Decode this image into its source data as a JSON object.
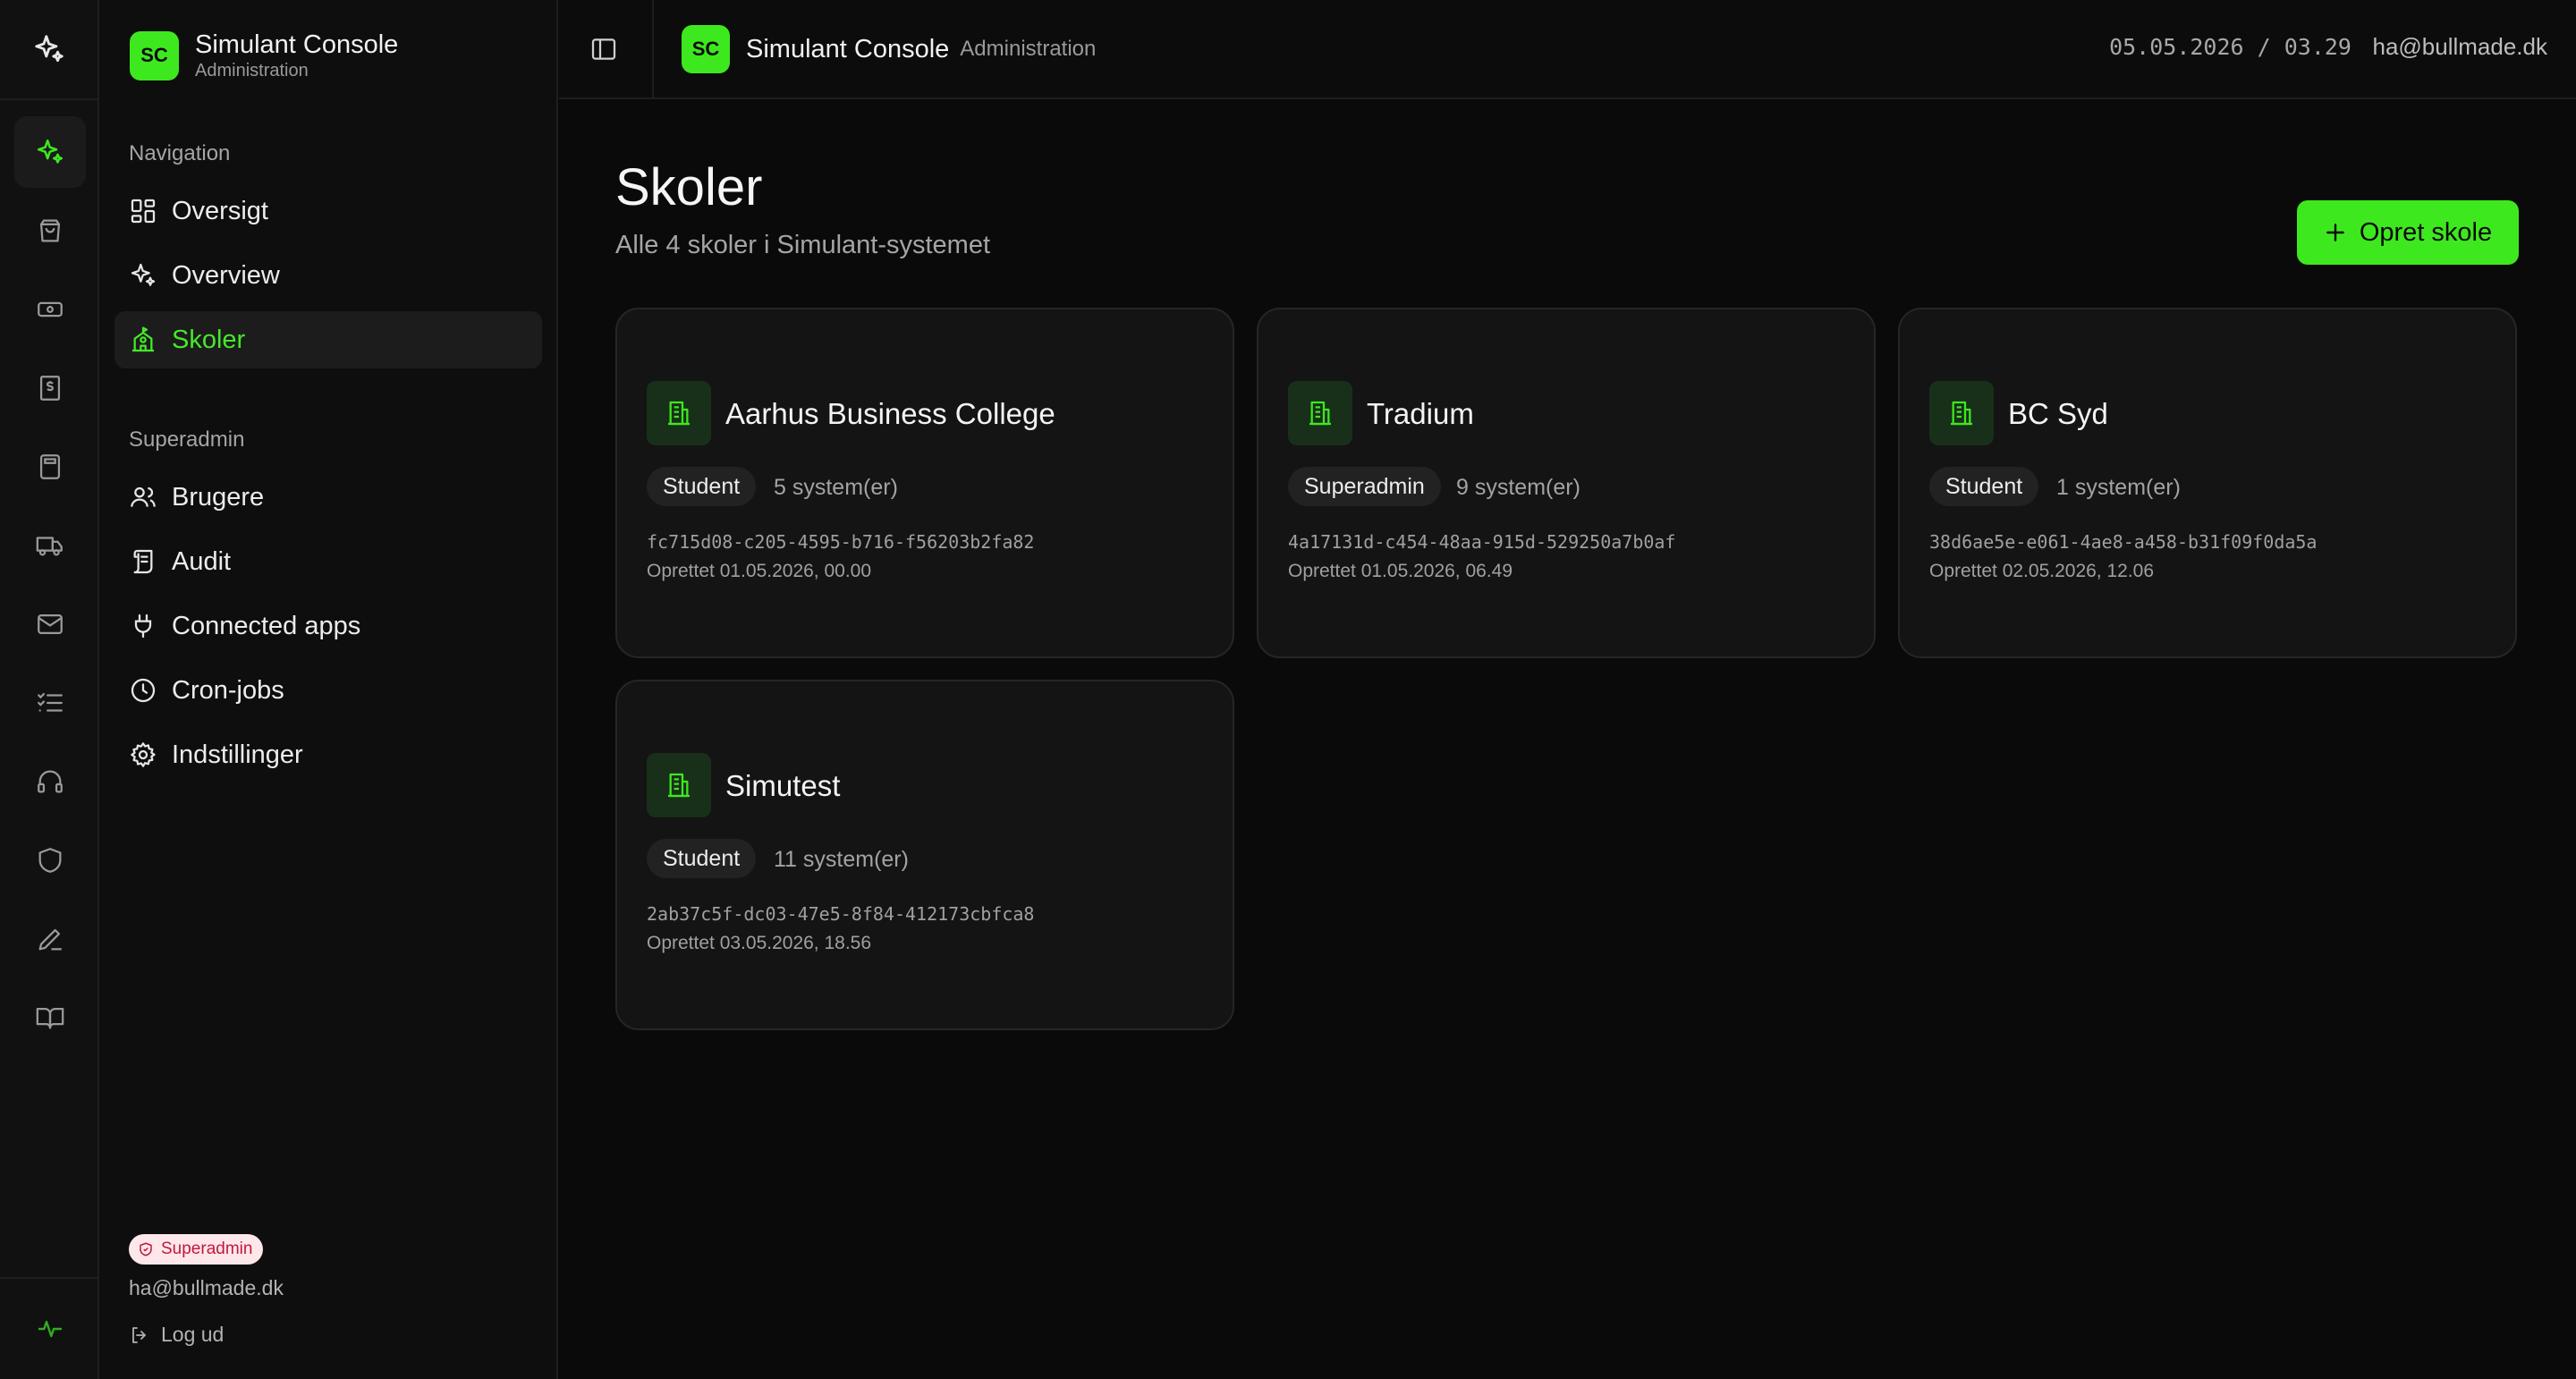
{
  "app": {
    "badge": "SC",
    "title": "Simulant Console",
    "subtitle": "Administration"
  },
  "colors": {
    "accent": "#3ee81f",
    "background": "#0a0a0a",
    "superadmin_badge_bg": "#fde7ea",
    "superadmin_badge_text": "#c2183d"
  },
  "rail": {
    "icons": [
      "sparkles-icon",
      "shopping-bag-icon",
      "banknote-icon",
      "receipt-dollar-icon",
      "calculator-icon",
      "truck-icon",
      "mail-icon",
      "checklist-icon",
      "headphones-icon",
      "shield-icon",
      "pencil-icon",
      "book-open-icon"
    ],
    "active_icon": "sparkles-icon",
    "footer_icon": "activity-icon"
  },
  "sidebar": {
    "navigation_label": "Navigation",
    "navigation": [
      {
        "label": "Oversigt",
        "icon": "dashboard-icon"
      },
      {
        "label": "Overview",
        "icon": "sparkles-icon"
      },
      {
        "label": "Skoler",
        "icon": "school-icon",
        "active": true
      }
    ],
    "superadmin_label": "Superadmin",
    "superadmin": [
      {
        "label": "Brugere",
        "icon": "users-icon"
      },
      {
        "label": "Audit",
        "icon": "scroll-icon"
      },
      {
        "label": "Connected apps",
        "icon": "plug-icon"
      },
      {
        "label": "Cron-jobs",
        "icon": "clock-icon"
      },
      {
        "label": "Indstillinger",
        "icon": "gear-icon"
      }
    ],
    "role_badge": "Superadmin",
    "email": "ha@bullmade.dk",
    "logout": "Log ud"
  },
  "header": {
    "datetime": "05.05.2026 / 03.29",
    "email": "ha@bullmade.dk"
  },
  "main": {
    "title": "Skoler",
    "subtitle": "Alle 4 skoler i Simulant-systemet",
    "create_button": "Opret skole",
    "schools": [
      {
        "name": "Aarhus Business College",
        "role": "Student",
        "systems": "5 system(er)",
        "id": "fc715d08-c205-4595-b716-f56203b2fa82",
        "created": "Oprettet 01.05.2026, 00.00"
      },
      {
        "name": "Tradium",
        "role": "Superadmin",
        "systems": "9 system(er)",
        "id": "4a17131d-c454-48aa-915d-529250a7b0af",
        "created": "Oprettet 01.05.2026, 06.49"
      },
      {
        "name": "BC Syd",
        "role": "Student",
        "systems": "1 system(er)",
        "id": "38d6ae5e-e061-4ae8-a458-b31f09f0da5a",
        "created": "Oprettet 02.05.2026, 12.06"
      },
      {
        "name": "Simutest",
        "role": "Student",
        "systems": "11 system(er)",
        "id": "2ab37c5f-dc03-47e5-8f84-412173cbfca8",
        "created": "Oprettet 03.05.2026, 18.56"
      }
    ]
  }
}
